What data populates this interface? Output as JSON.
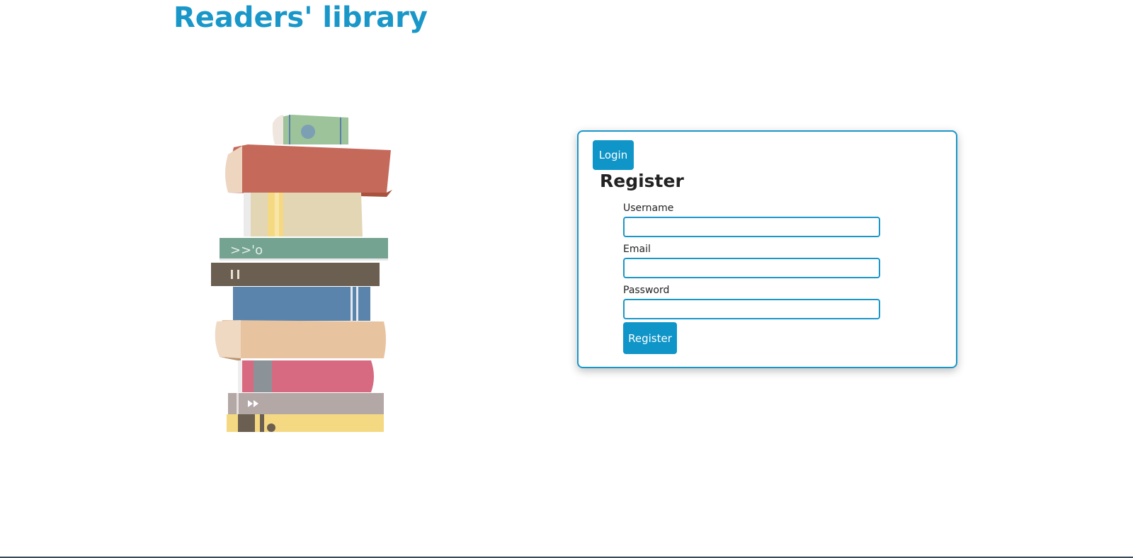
{
  "header": {
    "title": "Readers' library"
  },
  "illustration": {
    "icon": "book-stack-illustration",
    "colors": {
      "green": "#9dc39a",
      "red": "#c5695a",
      "cream": "#e2d6b5",
      "teal": "#74a391",
      "brown": "#6b5f52",
      "blue": "#5b84ad",
      "tan": "#e8c39f",
      "pink": "#d76a81",
      "gray": "#b3a8a6",
      "yellow": "#f5d982"
    }
  },
  "card": {
    "login_label": "Login",
    "title": "Register",
    "fields": [
      {
        "label": "Username",
        "value": "",
        "placeholder": ""
      },
      {
        "label": "Email",
        "value": "",
        "placeholder": ""
      },
      {
        "label": "Password",
        "value": "",
        "placeholder": ""
      }
    ],
    "register_label": "Register"
  },
  "theme": {
    "accent": "#1a97c9",
    "button": "#0f95c8"
  }
}
